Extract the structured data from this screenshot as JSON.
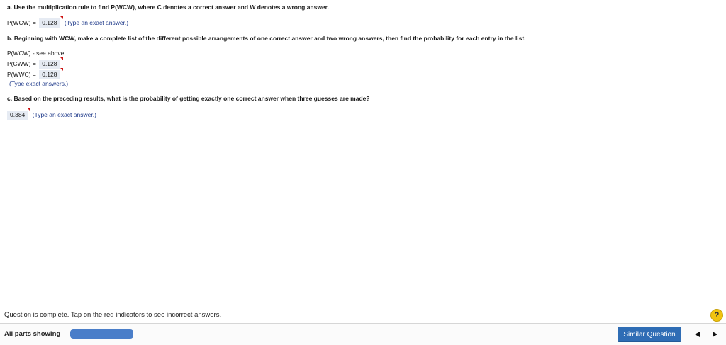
{
  "question": {
    "part_a": {
      "prompt": "a. Use the multiplication rule to find P(WCW), where C denotes a correct answer and W denotes a wrong answer.",
      "label": "P(WCW) =",
      "value": "0.128",
      "hint": "(Type an exact answer.)"
    },
    "part_b": {
      "prompt": "b. Beginning with WCW, make a complete list of the different possible arrangements of one correct answer and two wrong answers, then find the probability for each entry in the list.",
      "rows": [
        {
          "label": "P(WCW) - see above",
          "value": ""
        },
        {
          "label": "P(CWW) =",
          "value": "0.128"
        },
        {
          "label": "P(WWC) =",
          "value": "0.128"
        }
      ],
      "hint": "(Type exact answers.)"
    },
    "part_c": {
      "prompt": "c. Based on the preceding results, what is the probability of getting exactly one correct answer when three guesses are made?",
      "value": "0.384",
      "hint": "(Type an exact answer.)"
    }
  },
  "status_text": "Question is complete. Tap on the red indicators to see incorrect answers.",
  "help_icon": "?",
  "footer": {
    "parts_label": "All parts showing",
    "progress": 1.0,
    "similar_button": "Similar Question",
    "prev_icon": "left-triangle",
    "next_icon": "right-triangle"
  },
  "colors": {
    "answer_bg": "#e6ebf3",
    "flag": "#cc1111",
    "hint": "#1f3a8a",
    "progress": "#4a7ec9",
    "button": "#2f6db5",
    "help": "#f1c40f"
  }
}
